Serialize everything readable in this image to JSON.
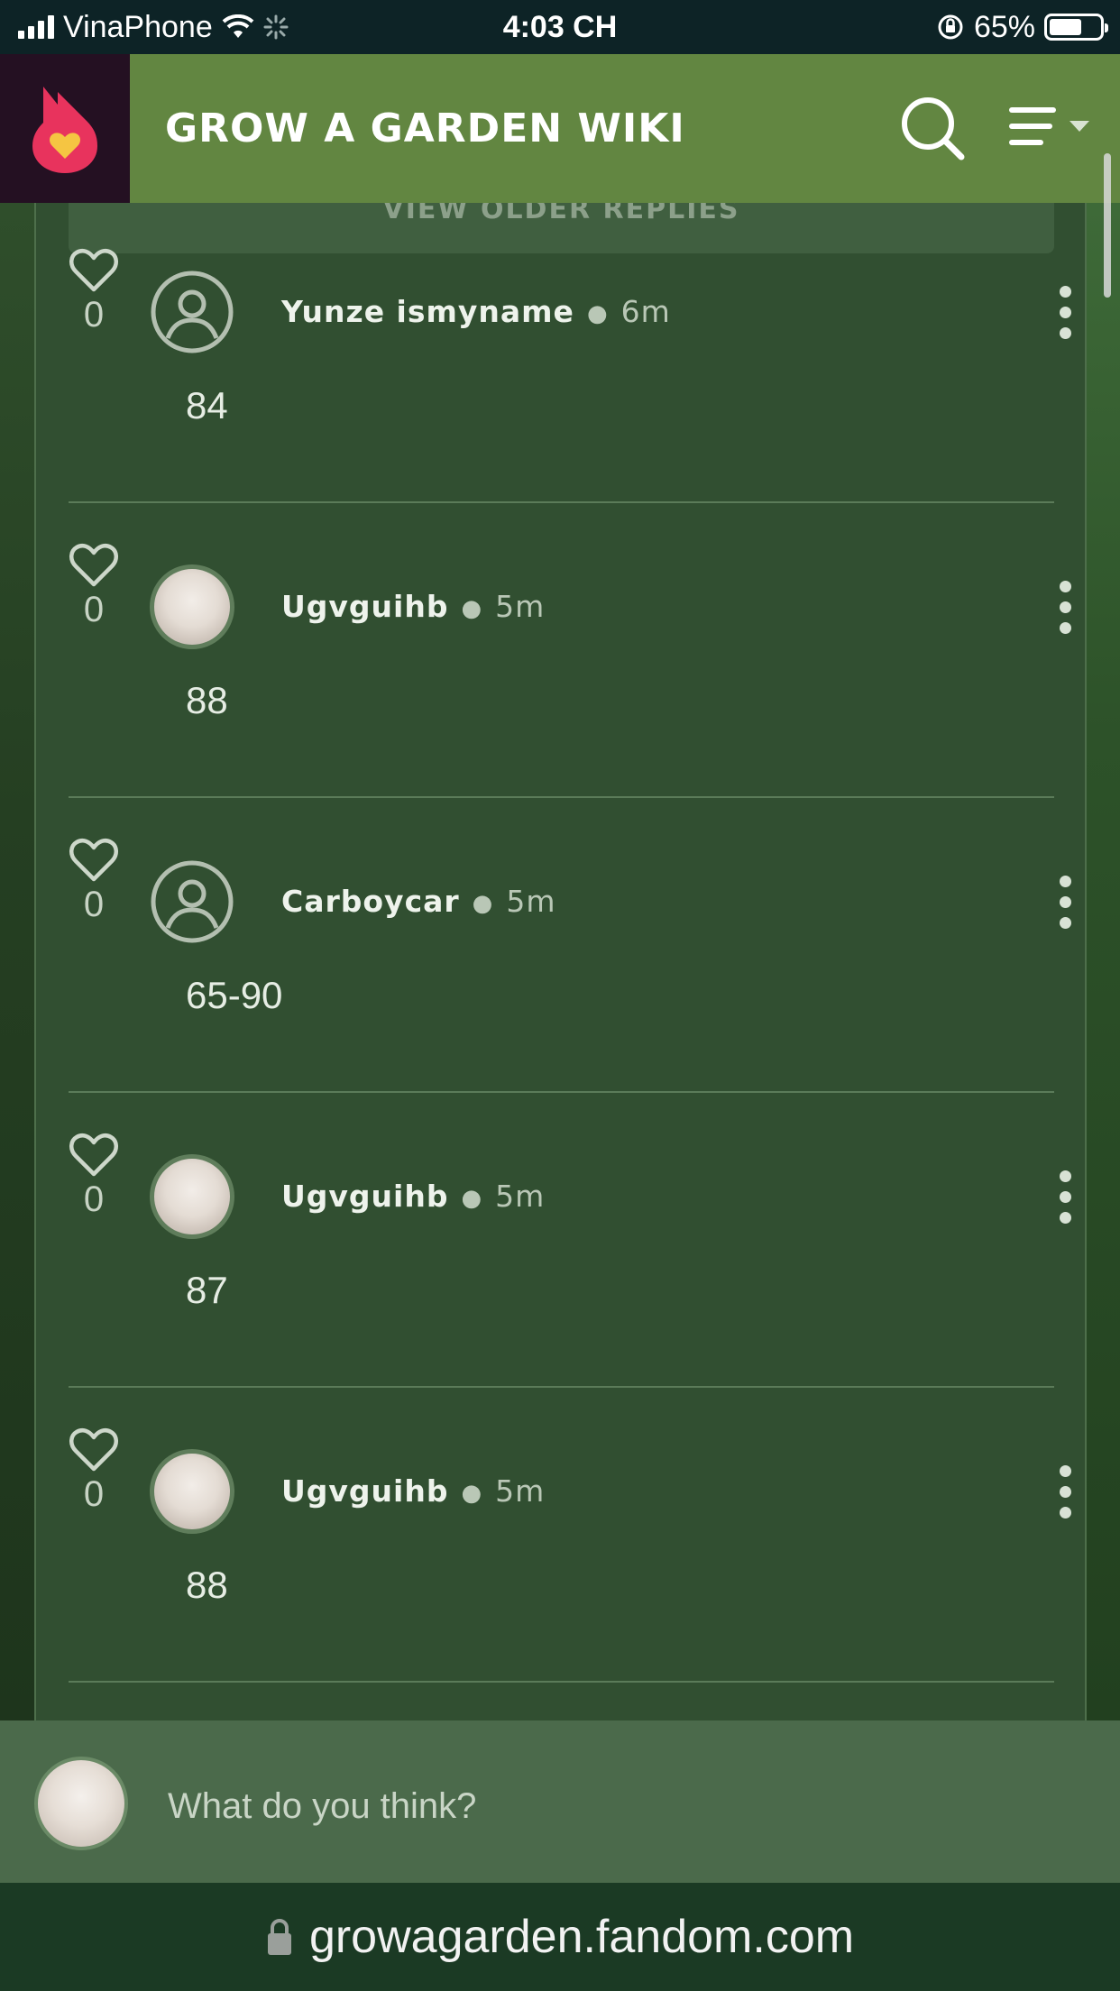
{
  "status_bar": {
    "carrier": "VinaPhone",
    "time": "4:03 CH",
    "battery": "65%",
    "battery_level": 0.65
  },
  "header": {
    "wiki_title": "GROW A GARDEN WIKI",
    "search_icon": "search-icon",
    "menu_icon": "menu-icon"
  },
  "older_replies_label": "VIEW OLDER REPLIES",
  "comments": [
    {
      "username": "Yunze ismyname",
      "time": "6m",
      "likes": "0",
      "text": "84",
      "avatar": "default"
    },
    {
      "username": "Ugvguihb",
      "time": "5m",
      "likes": "0",
      "text": "88",
      "avatar": "photo"
    },
    {
      "username": "Carboycar",
      "time": "5m",
      "likes": "0",
      "text": "65-90",
      "avatar": "default"
    },
    {
      "username": "Ugvguihb",
      "time": "5m",
      "likes": "0",
      "text": "87",
      "avatar": "photo"
    },
    {
      "username": "Ugvguihb",
      "time": "5m",
      "likes": "0",
      "text": "88",
      "avatar": "photo"
    }
  ],
  "reply": {
    "placeholder": "What do you think?"
  },
  "url_bar": {
    "url": "growagarden.fandom.com"
  },
  "colors": {
    "header": "#628641",
    "panel": "#314f31",
    "logo_bg": "#241022",
    "logo_flame": "#e8335d",
    "heart": "#f5c542"
  }
}
